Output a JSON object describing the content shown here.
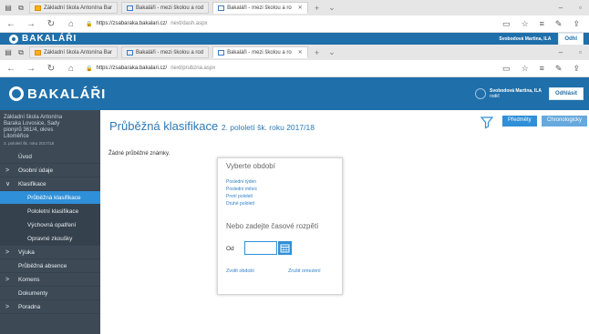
{
  "back_window": {
    "tabs": [
      {
        "label": "Základní škola Antonína Bar"
      },
      {
        "label": "Bakaláři - mezi školou a rod"
      },
      {
        "label": "Bakaláři - mezi školou a ro"
      }
    ],
    "url_host": "https://zsabaraka.bakalari.cz/",
    "url_path": "next/dash.aspx",
    "app_name": "BAKALÁŘI",
    "user_name": "Svobodová Martina, ILA",
    "logout": "Odhl"
  },
  "browser": {
    "tabs": [
      {
        "label": "Základní škola Antonína Bar"
      },
      {
        "label": "Bakaláři - mezi školou a rod"
      },
      {
        "label": "Bakaláři - mezi školou a ro"
      }
    ],
    "url_host": "https://zsabaraka.bakalari.cz/",
    "url_path": "next/prubzna.aspx",
    "new_tab": "+",
    "tab_dropdown": "⌄"
  },
  "header": {
    "app_name": "BAKALÁŘI",
    "user_name": "Svobodová Martina, ILA",
    "user_role": "rodič",
    "logout": "Odhlásit"
  },
  "sidebar": {
    "school_lines": [
      "Základní škola Antonína",
      "Baraka Lovosice, Sady",
      "pionýrů 361/4, okres",
      "Litoměřice"
    ],
    "school_small": "2. pololetí šk. roku 2017/18",
    "items": [
      {
        "label": "Úvod",
        "chev": ""
      },
      {
        "label": "Osobní údaje",
        "chev": ">"
      },
      {
        "label": "Klasifikace",
        "chev": "∨"
      },
      {
        "label": "Průběžná klasifikace",
        "chev": ""
      },
      {
        "label": "Pololetní klasifikace",
        "chev": ""
      },
      {
        "label": "Výchovná opatření",
        "chev": ""
      },
      {
        "label": "Opravné zkoušky",
        "chev": ""
      },
      {
        "label": "Výuka",
        "chev": ">"
      },
      {
        "label": "Průběžná absence",
        "chev": ""
      },
      {
        "label": "Komens",
        "chev": ">"
      },
      {
        "label": "Dokumenty",
        "chev": ""
      },
      {
        "label": "Poradna",
        "chev": ">"
      }
    ]
  },
  "main": {
    "title": "Průběžná klasifikace",
    "subtitle": "2. pololetí šk. roku 2017/18",
    "btn_predmety": "Předměty",
    "btn_chron": "Chronologicky",
    "empty": "Žádné průběžné známky."
  },
  "popup": {
    "title": "Vyberte období",
    "links": [
      "Poslední týden",
      "Poslední měsíc",
      "První pololetí",
      "Druhé pololetí"
    ],
    "custom_title": "Nebo zadejte časové rozpětí",
    "from_label": "Od",
    "from_value": "",
    "select": "Zvolit období",
    "cancel": "Zrušit omezení"
  },
  "colors": {
    "header_blue": "#1f6faa",
    "accent": "#2f8fd8",
    "sidebar": "#3d4a56"
  }
}
